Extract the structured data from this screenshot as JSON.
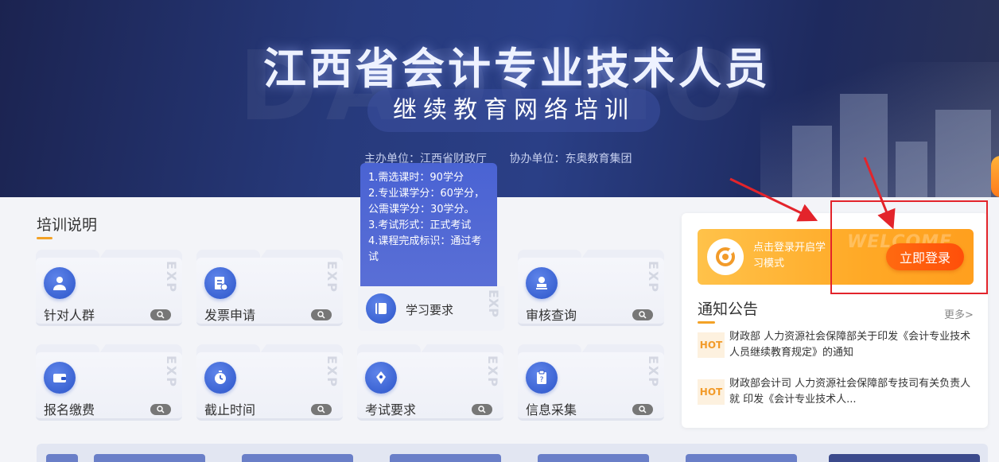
{
  "banner": {
    "title": "江西省会计专业技术人员",
    "subtitle": "继续教育网络培训",
    "host": "主办单位：江西省财政厅",
    "co_host": "协办单位：东奥教育集团"
  },
  "training": {
    "section_title": "培训说明",
    "cards": [
      {
        "label": "针对人群",
        "icon": "people-icon"
      },
      {
        "label": "发票申请",
        "icon": "invoice-icon"
      },
      {
        "label": "学习要求",
        "icon": "book-icon"
      },
      {
        "label": "审核查询",
        "icon": "stamp-icon"
      },
      {
        "label": "报名缴费",
        "icon": "wallet-icon"
      },
      {
        "label": "截止时间",
        "icon": "stopwatch-icon"
      },
      {
        "label": "考试要求",
        "icon": "pen-icon"
      },
      {
        "label": "信息采集",
        "icon": "clipboard-icon"
      }
    ],
    "tooltip": [
      "1.需选课时：90学分",
      "2.专业课学分：60学分，公需课学分：30学分。",
      "3.考试形式：正式考试",
      "4.课程完成标识：通过考试"
    ]
  },
  "login": {
    "hint": "点击登录开启学习模式",
    "button": "立即登录"
  },
  "notices": {
    "title": "通知公告",
    "more": "更多>",
    "items": [
      {
        "badge": "HOT",
        "text": "财政部 人力资源社会保障部关于印发《会计专业技术人员继续教育规定》的通知"
      },
      {
        "badge": "HOT",
        "text": "财政部会计司 人力资源社会保障部专技司有关负责人就 印发《会计专业技术人..."
      }
    ]
  },
  "colors": {
    "accent": "#f3a227",
    "primary": "#2c55c9",
    "login_button": "#ff5a0d",
    "annotation": "#e3242b"
  }
}
